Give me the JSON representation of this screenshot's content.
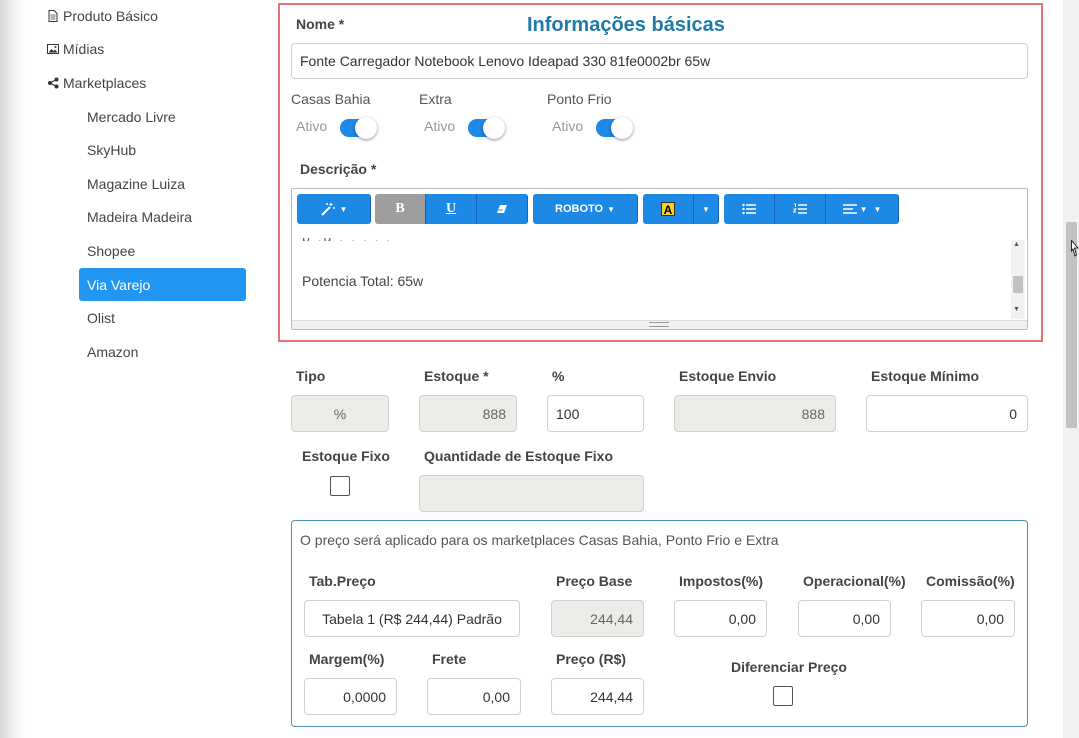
{
  "sidebar": {
    "produto_basico": "Produto Básico",
    "midias": "Mídias",
    "marketplaces": "Marketplaces",
    "items": [
      "Mercado Livre",
      "SkyHub",
      "Magazine Luiza",
      "Madeira Madeira",
      "Shopee",
      "Via Varejo",
      "Olist",
      "Amazon"
    ],
    "active": "Via Varejo"
  },
  "info": {
    "title": "Informações básicas",
    "nome_label": "Nome *",
    "nome_value": "Fonte Carregador Notebook Lenovo Ideapad 330 81fe0002br 65w",
    "channels": [
      {
        "name": "Casas Bahia",
        "status": "Ativo"
      },
      {
        "name": "Extra",
        "status": "Ativo"
      },
      {
        "name": "Ponto Frio",
        "status": "Ativo"
      }
    ],
    "descricao_label": "Descrição *",
    "font_button": "ROBOTO",
    "editor_text": "Potencia Total: 65w"
  },
  "stock": {
    "tipo_label": "Tipo",
    "tipo_value": "%",
    "estoque_label": "Estoque *",
    "estoque_value": "888",
    "pct_label": "%",
    "pct_value": "100",
    "envio_label": "Estoque Envio",
    "envio_value": "888",
    "minimo_label": "Estoque Mínimo",
    "minimo_value": "0",
    "fixo_label": "Estoque Fixo",
    "qtd_fixo_label": "Quantidade de Estoque Fixo",
    "qtd_fixo_value": ""
  },
  "price": {
    "note": "O preço será aplicado para os marketplaces Casas Bahia, Ponto Frio e Extra",
    "tab_label": "Tab.Preço",
    "tab_value": "Tabela 1 (R$ 244,44) Padrão",
    "base_label": "Preço Base",
    "base_value": "244,44",
    "impostos_label": "Impostos(%)",
    "impostos_value": "0,00",
    "operacional_label": "Operacional(%)",
    "operacional_value": "0,00",
    "comissao_label": "Comissão(%)",
    "comissao_value": "0,00",
    "margem_label": "Margem(%)",
    "margem_value": "0,0000",
    "frete_label": "Frete",
    "frete_value": "0,00",
    "preco_label": "Preço (R$)",
    "preco_value": "244,44",
    "diferenciar_label": "Diferenciar Preço"
  },
  "colors": {
    "accent": "#2196f3",
    "title": "#1f7aa8",
    "highlight_border": "#e57373"
  },
  "icons": [
    "document-icon",
    "image-icon",
    "share-icon",
    "magic-wand-icon",
    "bold-icon",
    "underline-icon",
    "eraser-icon",
    "font-color-icon",
    "bullet-list-icon",
    "numbered-list-icon",
    "align-icon"
  ]
}
